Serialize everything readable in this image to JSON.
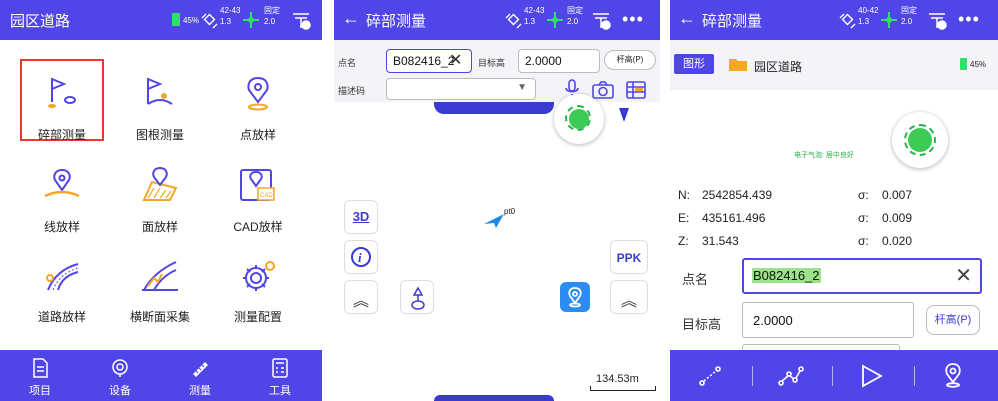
{
  "panel1": {
    "title": "园区道路",
    "battery": "45%",
    "sat_top": "42-43",
    "sat_bottom": "1.3",
    "fix_top": "固定",
    "fix_bottom": "2.0",
    "grid": [
      {
        "label": "碎部测量",
        "icon": "flag-points-icon",
        "selected": true
      },
      {
        "label": "图根测量",
        "icon": "flag-route-icon"
      },
      {
        "label": "点放样",
        "icon": "map-pin-icon"
      },
      {
        "label": "线放样",
        "icon": "line-stakeout-icon"
      },
      {
        "label": "面放样",
        "icon": "area-stakeout-icon"
      },
      {
        "label": "CAD放样",
        "icon": "cad-stakeout-icon"
      },
      {
        "label": "道路放样",
        "icon": "road-stakeout-icon"
      },
      {
        "label": "横断面采集",
        "icon": "cross-section-icon"
      },
      {
        "label": "测量配置",
        "icon": "gear-settings-icon"
      }
    ],
    "nav": [
      "项目",
      "设备",
      "测量",
      "工具"
    ],
    "accent": "#5045e6"
  },
  "panel2": {
    "title": "碎部测量",
    "sat_top": "42-43",
    "sat_bottom": "1.3",
    "fix_top": "固定",
    "fix_bottom": "2.0",
    "point_name_label": "点名",
    "point_name_value": "B082416_2",
    "target_height_label": "目标高",
    "target_height_value": "2.0000",
    "pole_height_btn": "杆高(P)",
    "desc_label": "描述码",
    "btn_3d": "3D",
    "btn_ppk": "PPK",
    "point_marker_label": "pt0",
    "scale": "134.53m"
  },
  "panel3": {
    "title": "碎部测量",
    "sat_top": "40-42",
    "sat_bottom": "1.3",
    "fix_top": "固定",
    "fix_bottom": "2.0",
    "tab_graphic": "图形",
    "folder_name": "园区道路",
    "battery": "45%",
    "bubble_text": "电子气泡: 居中良好",
    "n_label": "N:",
    "n_value": "2542854.439",
    "e_label": "E:",
    "e_value": "435161.496",
    "z_label": "Z:",
    "z_value": "31.543",
    "sigma_label": "σ:",
    "sigma_n": "0.007",
    "sigma_e": "0.009",
    "sigma_z": "0.020",
    "point_name_label": "点名",
    "point_name_value": "B082416_2",
    "target_height_label": "目标高",
    "target_height_value": "2.0000",
    "pole_height_btn": "杆高(P)"
  }
}
